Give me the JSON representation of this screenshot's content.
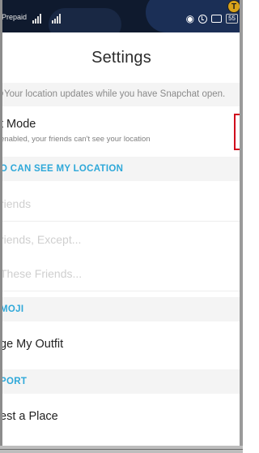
{
  "status_bar": {
    "carrier": "Prepaid",
    "battery": "55",
    "badge": "T"
  },
  "header": {
    "title": "Settings"
  },
  "info_banner": {
    "text": "Your location updates while you have Snapchat open."
  },
  "ghost_mode": {
    "title": "t Mode",
    "subtitle": "enabled, your friends can't see your location"
  },
  "who_can_see": {
    "header": "O CAN SEE MY LOCATION",
    "options": [
      {
        "label": "riends"
      },
      {
        "label": "riends, Except..."
      },
      {
        "label": " These Friends..."
      }
    ]
  },
  "bitmoji": {
    "header": "MOJI",
    "item": "ge My Outfit"
  },
  "support": {
    "header": "PORT",
    "item": "est a Place"
  },
  "colors": {
    "accent": "#2ea8d9",
    "highlight": "#d0021b",
    "status_bg": "#0f1a2e"
  }
}
